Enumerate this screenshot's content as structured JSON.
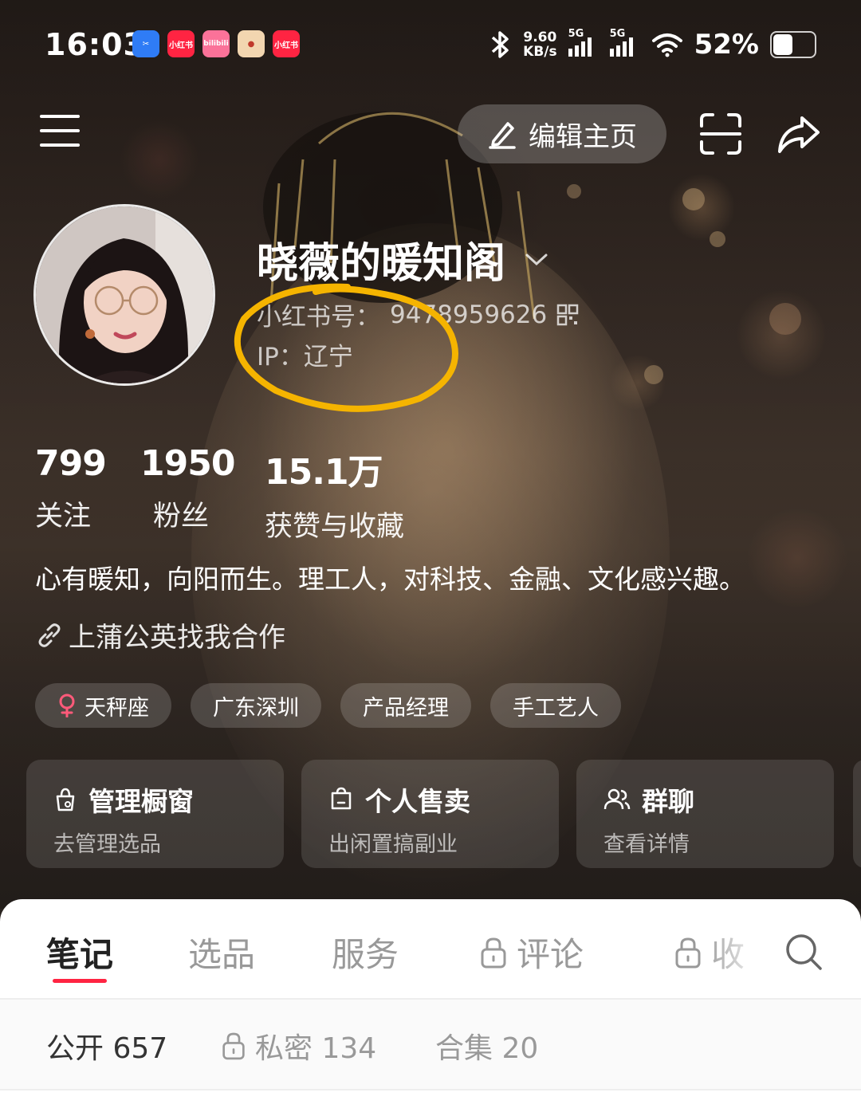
{
  "status_bar": {
    "time": "16:03",
    "apps": [
      {
        "name": "tv-app-icon",
        "color": "#2f7cf6",
        "label": ""
      },
      {
        "name": "xiaohongshu-icon",
        "color": "#ff2442",
        "label": "小红书"
      },
      {
        "name": "bilibili-icon",
        "color": "#fb7299",
        "label": "bilibili"
      },
      {
        "name": "game-app-icon",
        "color": "#f0a040",
        "label": ""
      },
      {
        "name": "xiaohongshu-icon-2",
        "color": "#ff2442",
        "label": "小红书"
      }
    ],
    "net_speed": "9.60",
    "net_unit": "KB/s",
    "signal_1": "5G",
    "signal_2": "5G",
    "battery": "52%",
    "battery_level": 0.52
  },
  "header": {
    "edit_label": "编辑主页"
  },
  "profile": {
    "nickname": "晓薇的暖知阁",
    "red_id_label": "小红书号：",
    "red_id": "9478959626",
    "ip": "IP：辽宁"
  },
  "stats": [
    {
      "num": "799",
      "label": "关注"
    },
    {
      "num": "1950",
      "label": "粉丝"
    },
    {
      "num": "15.1万",
      "label": "获赞与收藏"
    }
  ],
  "bio": "心有暖知，向阳而生。理工人，对科技、金融、文化感兴趣。",
  "cooperation": "上蒲公英找我合作",
  "tags": [
    {
      "label": "天秤座",
      "icon": "female-icon"
    },
    {
      "label": "广东深圳"
    },
    {
      "label": "产品经理"
    },
    {
      "label": "手工艺人"
    }
  ],
  "cards": [
    {
      "title": "管理橱窗",
      "sub": "去管理选品",
      "icon": "shop-bag-icon"
    },
    {
      "title": "个人售卖",
      "sub": "出闲置搞副业",
      "icon": "sell-bag-icon"
    },
    {
      "title": "群聊",
      "sub": "查看详情",
      "icon": "group-icon"
    }
  ],
  "tabs": [
    {
      "label": "笔记",
      "active": true
    },
    {
      "label": "选品"
    },
    {
      "label": "服务"
    },
    {
      "label": "评论",
      "locked": true
    },
    {
      "label": "收",
      "locked": true
    }
  ],
  "subtabs": [
    {
      "label": "公开 657",
      "active": true
    },
    {
      "label": "私密 134",
      "locked": true
    },
    {
      "label": "合集 20"
    }
  ],
  "colors": {
    "accent": "#ff2442",
    "highlight_circle": "#f5b400"
  }
}
